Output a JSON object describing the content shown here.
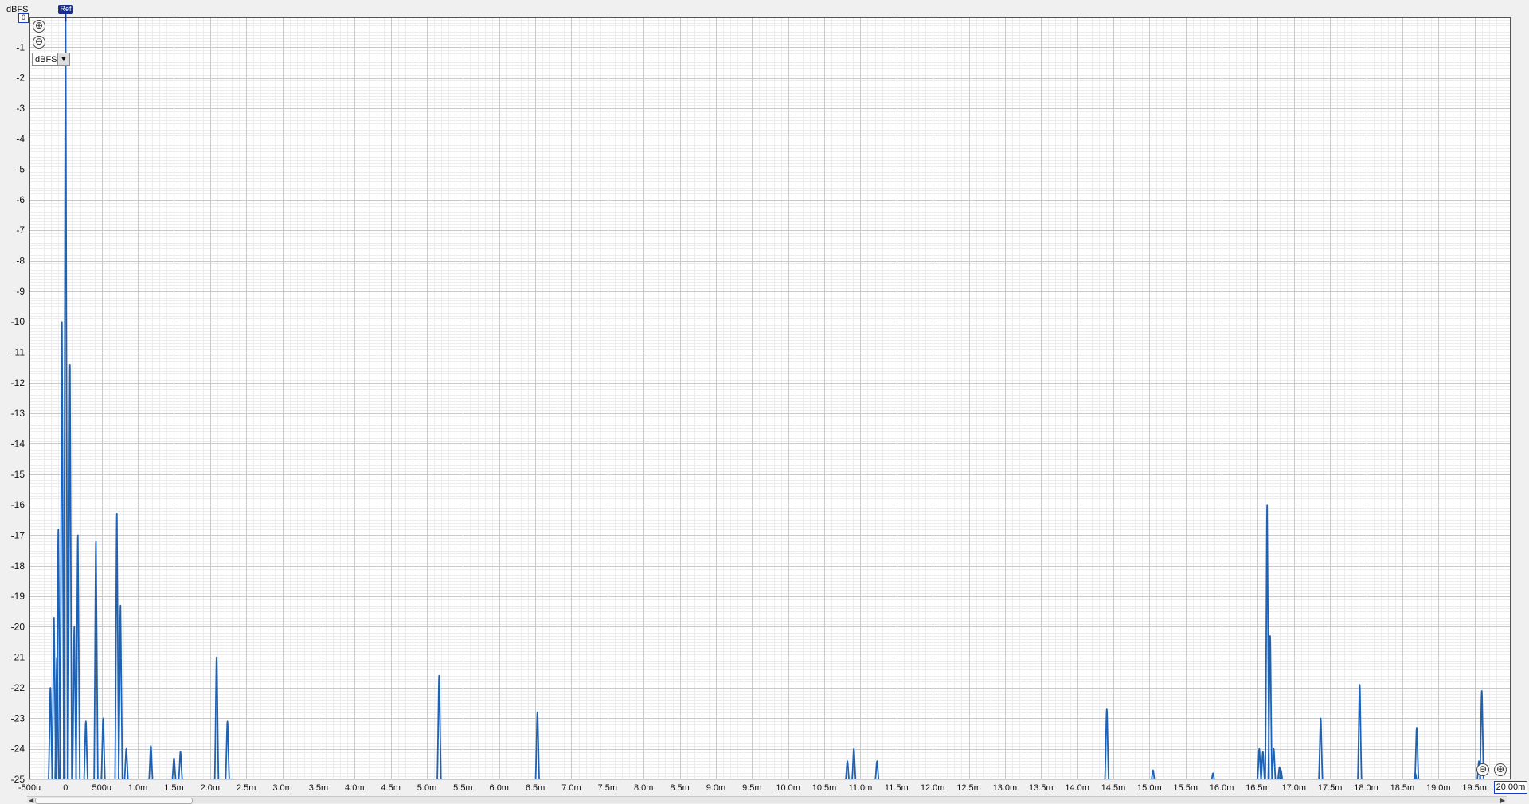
{
  "chart_data": {
    "type": "line",
    "title": "",
    "xlabel": "",
    "ylabel": "dBFS",
    "xlim": [
      -0.0005,
      0.02
    ],
    "ylim": [
      -25,
      0
    ],
    "grid": true,
    "y_ticks": [
      "0",
      "-1",
      "-2",
      "-3",
      "-4",
      "-5",
      "-6",
      "-7",
      "-8",
      "-9",
      "-10",
      "-11",
      "-12",
      "-13",
      "-14",
      "-15",
      "-16",
      "-17",
      "-18",
      "-19",
      "-20",
      "-21",
      "-22",
      "-23",
      "-24",
      "-25"
    ],
    "x_ticks": [
      "-500u",
      "0",
      "500u",
      "1.0m",
      "1.5m",
      "2.0m",
      "2.5m",
      "3.0m",
      "3.5m",
      "4.0m",
      "4.5m",
      "5.0m",
      "5.5m",
      "6.0m",
      "6.5m",
      "7.0m",
      "7.5m",
      "8.0m",
      "8.5m",
      "9.0m",
      "9.5m",
      "10.0m",
      "10.5m",
      "11.0m",
      "11.5m",
      "12.0m",
      "12.5m",
      "13.0m",
      "13.5m",
      "14.0m",
      "14.5m",
      "15.0m",
      "15.5m",
      "16.0m",
      "16.5m",
      "17.0m",
      "17.5m",
      "18.0m",
      "18.5m",
      "19.0m",
      "19.5m",
      "20.0m"
    ],
    "series": [
      {
        "color": "#1f62b4",
        "peaks": [
          [
            -0.00021,
            -22.0
          ],
          [
            -0.00016,
            -19.7
          ],
          [
            -0.00012,
            -21.0
          ],
          [
            -0.0001,
            -16.8
          ],
          [
            -5e-05,
            -10.0
          ],
          [
            0.0,
            0.0
          ],
          [
            6e-05,
            -11.4
          ],
          [
            0.00012,
            -20.0
          ],
          [
            0.00017,
            -17.0
          ],
          [
            0.00028,
            -23.1
          ],
          [
            0.00042,
            -17.2
          ],
          [
            0.00052,
            -23.0
          ],
          [
            0.00071,
            -16.3
          ],
          [
            0.00076,
            -19.3
          ],
          [
            0.00084,
            -24.0
          ],
          [
            0.00118,
            -23.9
          ],
          [
            0.0015,
            -24.3
          ],
          [
            0.00159,
            -24.1
          ],
          [
            0.00209,
            -21.0
          ],
          [
            0.00224,
            -23.1
          ],
          [
            0.00517,
            -21.6
          ],
          [
            0.00653,
            -22.8
          ],
          [
            0.01082,
            -24.4
          ],
          [
            0.01091,
            -24.0
          ],
          [
            0.01123,
            -24.4
          ],
          [
            0.01441,
            -22.7
          ],
          [
            0.01505,
            -24.7
          ],
          [
            0.01588,
            -24.8
          ],
          [
            0.01652,
            -24.0
          ],
          [
            0.01657,
            -24.1
          ],
          [
            0.01663,
            -16.0
          ],
          [
            0.01667,
            -20.3
          ],
          [
            0.01672,
            -24.0
          ],
          [
            0.0168,
            -24.6
          ],
          [
            0.01682,
            -24.7
          ],
          [
            0.01737,
            -23.0
          ],
          [
            0.01791,
            -21.9
          ],
          [
            0.01868,
            -24.8
          ],
          [
            0.0187,
            -23.3
          ],
          [
            0.01956,
            -24.4
          ],
          [
            0.0196,
            -22.1
          ]
        ]
      }
    ]
  },
  "ui": {
    "unit_label": "dBFS",
    "unit_select_value": "dBFS",
    "ref_label": "Ref",
    "top_value": "0",
    "x_end_value": "20.00m",
    "zoom_in_symbol": "⊕",
    "zoom_out_symbol": "⊖"
  }
}
